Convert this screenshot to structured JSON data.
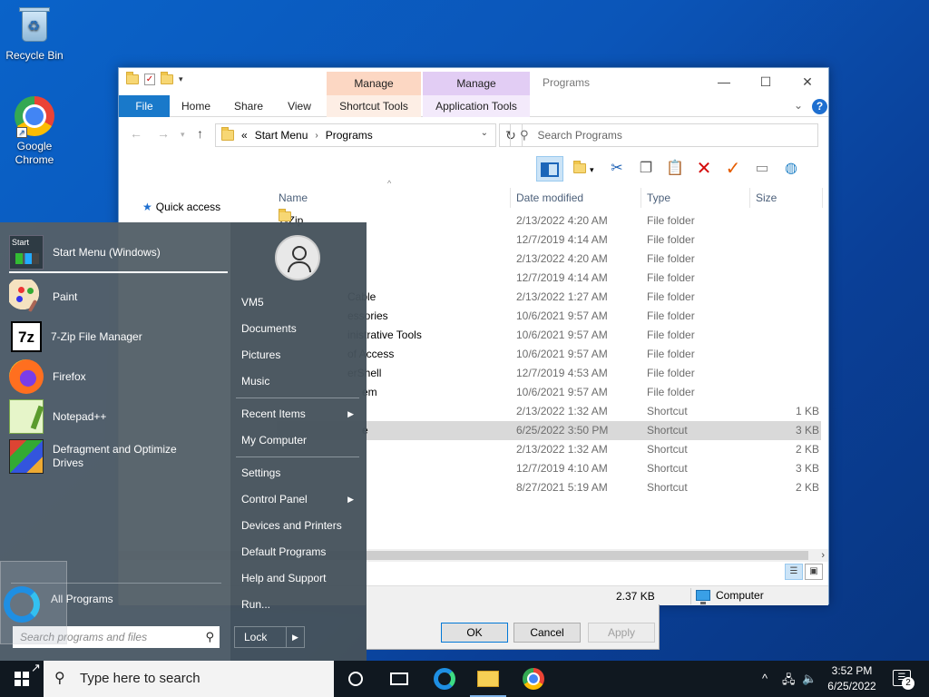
{
  "desktop": {
    "icons": [
      {
        "label": "Recycle Bin",
        "icon": "recycle-bin-icon"
      },
      {
        "label": "Google Chrome",
        "icon": "chrome-icon"
      }
    ]
  },
  "explorer": {
    "title": "Programs",
    "context_tabs": [
      {
        "header": "Manage",
        "tab": "Shortcut Tools",
        "color": "#fcd7c3"
      },
      {
        "header": "Manage",
        "tab": "Application Tools",
        "color": "#e2cdf4"
      }
    ],
    "ribbon_tabs": [
      "File",
      "Home",
      "Share",
      "View"
    ],
    "address": {
      "overflow": "«",
      "crumbs": [
        "Start Menu",
        "Programs"
      ]
    },
    "search_placeholder": "Search Programs",
    "nav_pane": {
      "quick_access": "Quick access"
    },
    "columns": {
      "name": "Name",
      "date": "Date modified",
      "type": "Type",
      "size": "Size"
    },
    "files": [
      {
        "name": "7-Zip",
        "date": "2/13/2022 4:20 AM",
        "type": "File folder",
        "size": "",
        "folder": true
      },
      {
        "name": "",
        "date": "12/7/2019 4:14 AM",
        "type": "File folder",
        "size": "",
        "folder": true
      },
      {
        "name": "",
        "date": "2/13/2022 4:20 AM",
        "type": "File folder",
        "size": "",
        "folder": true
      },
      {
        "name": "",
        "date": "12/7/2019 4:14 AM",
        "type": "File folder",
        "size": "",
        "folder": true
      },
      {
        "name": "Cable",
        "date": "2/13/2022 1:27 AM",
        "type": "File folder",
        "size": "",
        "folder": true
      },
      {
        "name": "essories",
        "date": "10/6/2021 9:57 AM",
        "type": "File folder",
        "size": "",
        "folder": true
      },
      {
        "name": "inistrative Tools",
        "date": "10/6/2021 9:57 AM",
        "type": "File folder",
        "size": "",
        "folder": true
      },
      {
        "name": "of Access",
        "date": "10/6/2021 9:57 AM",
        "type": "File folder",
        "size": "",
        "folder": true
      },
      {
        "name": "erShell",
        "date": "12/7/2019 4:53 AM",
        "type": "File folder",
        "size": "",
        "folder": true
      },
      {
        "name": "em",
        "date": "10/6/2021 9:57 AM",
        "type": "File folder",
        "size": "",
        "folder": true
      },
      {
        "name": "",
        "date": "2/13/2022 1:32 AM",
        "type": "Shortcut",
        "size": "1 KB",
        "folder": false
      },
      {
        "name": "e",
        "date": "6/25/2022 3:50 PM",
        "type": "Shortcut",
        "size": "3 KB",
        "folder": false,
        "selected": true
      },
      {
        "name": "",
        "date": "2/13/2022 1:32 AM",
        "type": "Shortcut",
        "size": "2 KB",
        "folder": false
      },
      {
        "name": "",
        "date": "12/7/2019 4:10 AM",
        "type": "Shortcut",
        "size": "3 KB",
        "folder": false
      },
      {
        "name": "",
        "date": "8/27/2021 5:19 AM",
        "type": "Shortcut",
        "size": "2 KB",
        "folder": false
      }
    ],
    "status": {
      "size": "2.37 KB",
      "location": "Computer"
    }
  },
  "dialog": {
    "ok": "OK",
    "cancel": "Cancel",
    "apply": "Apply"
  },
  "start_menu": {
    "pinned": [
      {
        "label": "Start Menu (Windows)",
        "icon": "start-menu-icon"
      },
      {
        "label": "Paint",
        "icon": "paint-icon"
      },
      {
        "label": "7-Zip File Manager",
        "icon": "7zip-icon"
      },
      {
        "label": "Firefox",
        "icon": "firefox-icon"
      },
      {
        "label": "Notepad++",
        "icon": "notepadpp-icon"
      },
      {
        "label": "Defragment and Optimize Drives",
        "icon": "defrag-icon"
      }
    ],
    "all_programs": "All Programs",
    "search_placeholder": "Search programs and files",
    "right": [
      {
        "label": "VM5"
      },
      {
        "label": "Documents"
      },
      {
        "label": "Pictures"
      },
      {
        "label": "Music"
      },
      {
        "label": "Recent Items",
        "submenu": true
      },
      {
        "label": "My Computer"
      },
      {
        "label": "Settings"
      },
      {
        "label": "Control Panel",
        "submenu": true
      },
      {
        "label": "Devices and Printers"
      },
      {
        "label": "Default Programs"
      },
      {
        "label": "Help and Support"
      },
      {
        "label": "Run..."
      }
    ],
    "lock": "Lock"
  },
  "taskbar": {
    "search_placeholder": "Type here to search",
    "time": "3:52 PM",
    "date": "6/25/2022",
    "notifications": "2"
  }
}
